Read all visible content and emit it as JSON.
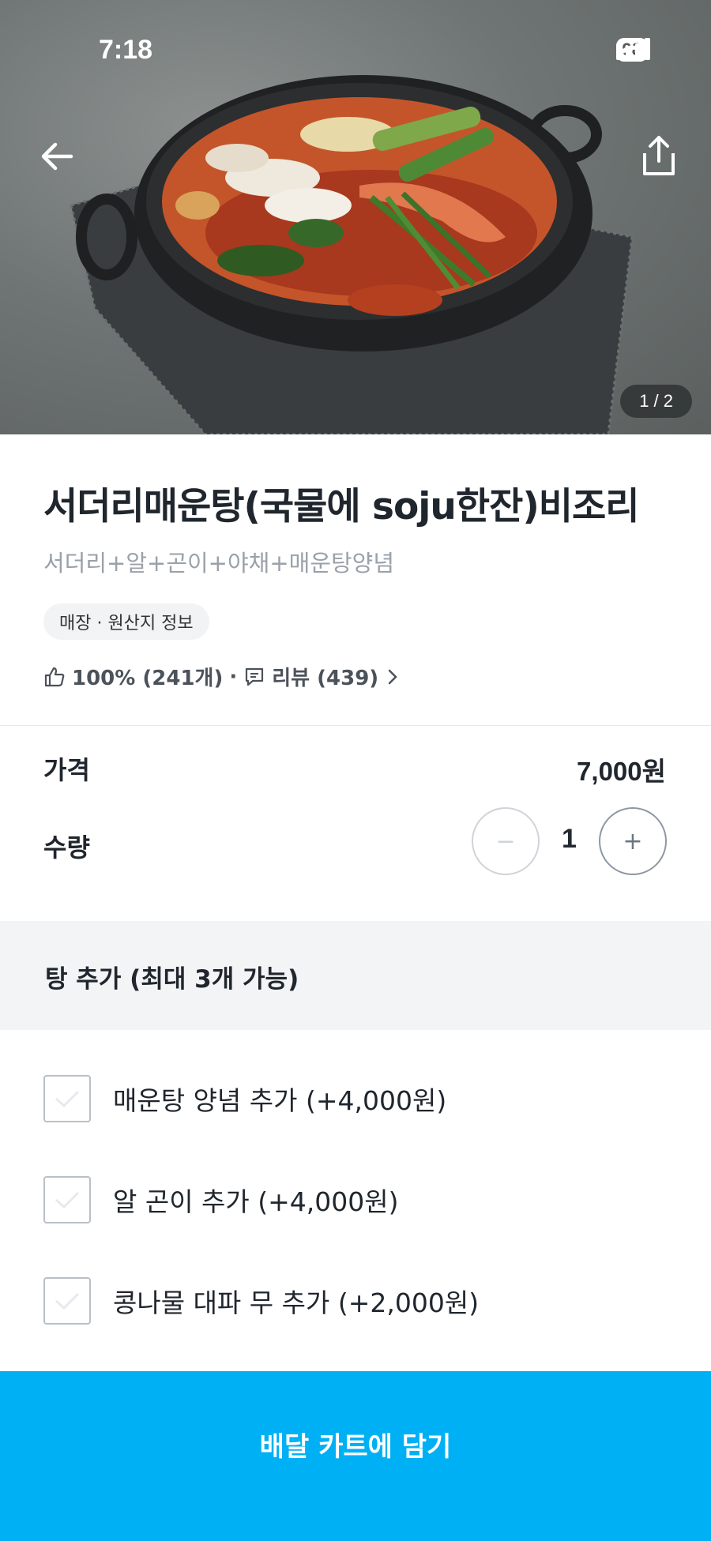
{
  "status_bar": {
    "time": "7:18",
    "battery": "98"
  },
  "gallery": {
    "counter": "1 / 2"
  },
  "product": {
    "title": "서더리매운탕(국물에 soju한잔)비조리",
    "subtitle": "서더리+알+곤이+야채+매운탕양념",
    "tag": "매장 · 원산지 정보",
    "rating": "100% (241개)",
    "separator": "·",
    "review": "리뷰 (439)"
  },
  "price": {
    "label": "가격",
    "value": "7,000원"
  },
  "quantity": {
    "label": "수량",
    "minus": "−",
    "value": "1",
    "plus": "+"
  },
  "options": {
    "title": "탕 추가 (최대 3개 가능)",
    "items": [
      {
        "label": "매운탕 양념 추가 (+4,000원)"
      },
      {
        "label": "알 곤이 추가 (+4,000원)"
      },
      {
        "label": "콩나물 대파 무 추가 (+2,000원)"
      }
    ]
  },
  "cta": {
    "label": "배달 카트에 담기"
  },
  "colors": {
    "accent": "#00b0f5",
    "text": "#20262d",
    "muted": "#9aa1a8"
  }
}
